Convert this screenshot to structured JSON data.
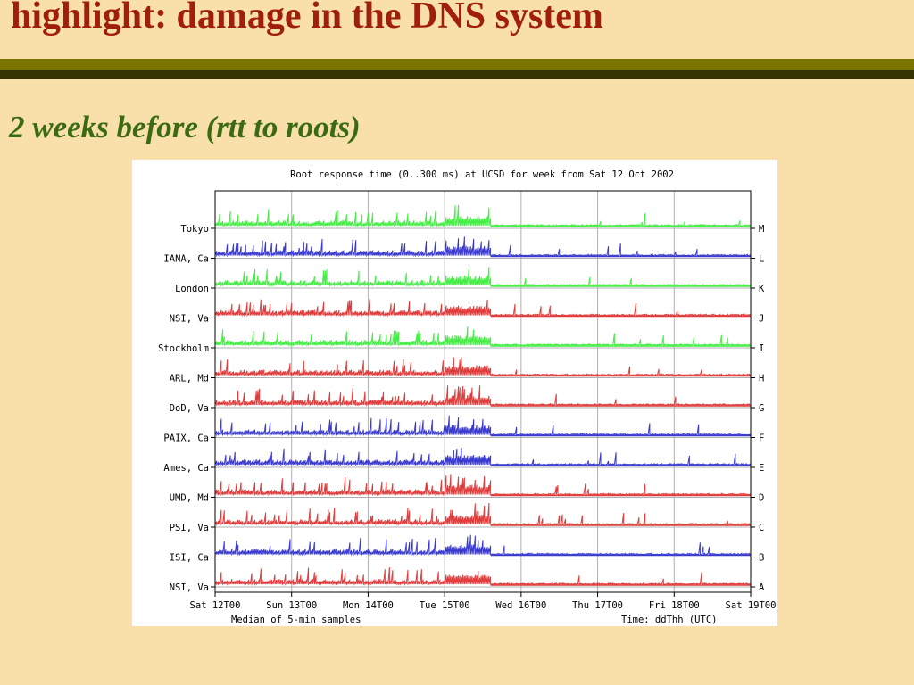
{
  "slide": {
    "title": "highlight: damage in the DNS system",
    "subtitle": "2 weeks before (rtt to roots)"
  },
  "chart_data": {
    "type": "line",
    "title": "Root response time (0..300 ms) at UCSD for week from Sat 12 Oct 2002",
    "xlabel_left": "Median of 5-min samples",
    "xlabel_right": "Time: ddThh (UTC)",
    "x_ticks": [
      "Sat 12T00",
      "Sun 13T00",
      "Mon 14T00",
      "Tue 15T00",
      "Wed 16T00",
      "Thu 17T00",
      "Fri 18T00",
      "Sat 19T00"
    ],
    "xlim_days": [
      12,
      19
    ],
    "ylim_ms": [
      0,
      300
    ],
    "grid": true,
    "colors": {
      "green": "#44ee44",
      "blue": "#3a3ad0",
      "red": "#e03c3c",
      "grid": "#b0b0b0"
    },
    "series": [
      {
        "letter": "M",
        "location": "Tokyo",
        "color": "green"
      },
      {
        "letter": "L",
        "location": "IANA, Ca",
        "color": "blue"
      },
      {
        "letter": "K",
        "location": "London",
        "color": "green"
      },
      {
        "letter": "J",
        "location": "NSI, Va",
        "color": "red"
      },
      {
        "letter": "I",
        "location": "Stockholm",
        "color": "green"
      },
      {
        "letter": "H",
        "location": "ARL, Md",
        "color": "red"
      },
      {
        "letter": "G",
        "location": "DoD, Va",
        "color": "red"
      },
      {
        "letter": "F",
        "location": "PAIX, Ca",
        "color": "blue"
      },
      {
        "letter": "E",
        "location": "Ames, Ca",
        "color": "blue"
      },
      {
        "letter": "D",
        "location": "UMD, Md",
        "color": "red"
      },
      {
        "letter": "C",
        "location": "PSI, Va",
        "color": "red"
      },
      {
        "letter": "B",
        "location": "ISI, Ca",
        "color": "blue"
      },
      {
        "letter": "A",
        "location": "NSI, Va",
        "color": "red"
      }
    ]
  }
}
